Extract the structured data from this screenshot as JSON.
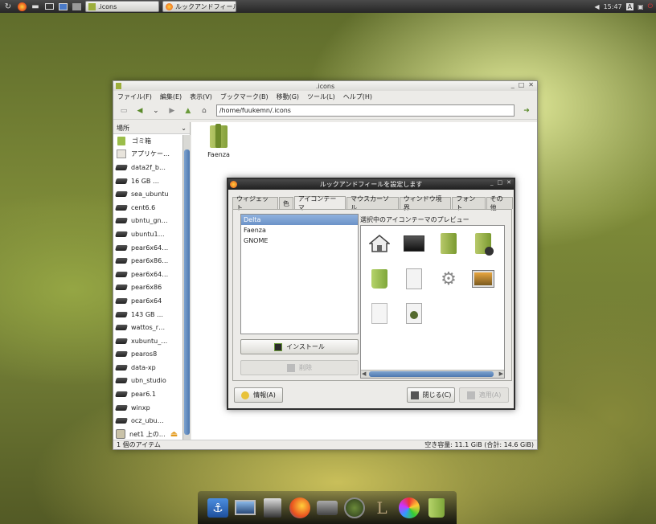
{
  "taskbar": {
    "task1_label": ".icons",
    "task2_label": "ルックアンドフィール…",
    "clock": "15:47",
    "lang_indicator": "A"
  },
  "file_manager": {
    "title": ".icons",
    "menu": [
      "ファイル(F)",
      "編集(E)",
      "表示(V)",
      "ブックマーク(B)",
      "移動(G)",
      "ツール(L)",
      "ヘルプ(H)"
    ],
    "location_path": "/home/fuukemn/.icons",
    "sidebar_header": "場所",
    "places": [
      {
        "label": "ゴミ箱",
        "icon": "trash-icon"
      },
      {
        "label": "アプリケー…",
        "icon": "applications-icon"
      },
      {
        "label": "data2f_b…",
        "icon": "drive-icon"
      },
      {
        "label": "16 GB …",
        "icon": "drive-icon"
      },
      {
        "label": "sea_ubuntu",
        "icon": "drive-icon"
      },
      {
        "label": "cent6.6",
        "icon": "drive-icon"
      },
      {
        "label": "ubntu_gn…",
        "icon": "drive-icon"
      },
      {
        "label": "ubuntu1…",
        "icon": "drive-icon"
      },
      {
        "label": "pear6x64…",
        "icon": "drive-icon"
      },
      {
        "label": "pear6x86…",
        "icon": "drive-icon"
      },
      {
        "label": "pear6x64…",
        "icon": "drive-icon"
      },
      {
        "label": "pear6x86",
        "icon": "drive-icon"
      },
      {
        "label": "pear6x64",
        "icon": "drive-icon"
      },
      {
        "label": "143 GB …",
        "icon": "drive-icon"
      },
      {
        "label": "wattos_r…",
        "icon": "drive-icon"
      },
      {
        "label": "xubuntu_…",
        "icon": "drive-icon"
      },
      {
        "label": "pearos8",
        "icon": "drive-icon"
      },
      {
        "label": "data-xp",
        "icon": "drive-icon"
      },
      {
        "label": "ubn_studio",
        "icon": "drive-icon"
      },
      {
        "label": "pear6.1",
        "icon": "drive-icon"
      },
      {
        "label": "winxp",
        "icon": "drive-icon"
      },
      {
        "label": "ocz_ubu…",
        "icon": "drive-icon"
      },
      {
        "label": "net1 上の…",
        "icon": "network-share-icon"
      }
    ],
    "folder_name": "Faenza",
    "status_left": "1 個のアイテム",
    "status_right": "空き容量: 11.1 GiB (合計: 14.6 GiB)"
  },
  "dialog": {
    "title": "ルックアンドフィールを設定します",
    "tabs": [
      "ウィジェット",
      "色",
      "アイコンテーマ",
      "マウスカーソル",
      "ウィンドウ境界",
      "フォント",
      "その他"
    ],
    "active_tab": "アイコンテーマ",
    "themes": [
      "Delta",
      "Faenza",
      "GNOME"
    ],
    "selected_theme": "Delta",
    "install_label": "インストール",
    "delete_label": "削除",
    "preview_label": "選択中のアイコンテーマのプレビュー",
    "preview_icons": [
      "home-icon",
      "desktop-icon",
      "folder-icon",
      "folder-remote-icon",
      "trash-icon",
      "text-file-icon",
      "gear-icon",
      "image-viewer-icon",
      "blank-document-icon",
      "script-file-icon"
    ],
    "info_label": "情報(A)",
    "close_label": "閉じる(C)",
    "apply_label": "適用(A)"
  },
  "dock_icons": [
    "anchor-icon",
    "monitor-icon",
    "terminal-icon",
    "firefox-icon",
    "camera-icon",
    "disk-icon",
    "tex-icon",
    "color-wheel-icon",
    "trash-icon"
  ]
}
